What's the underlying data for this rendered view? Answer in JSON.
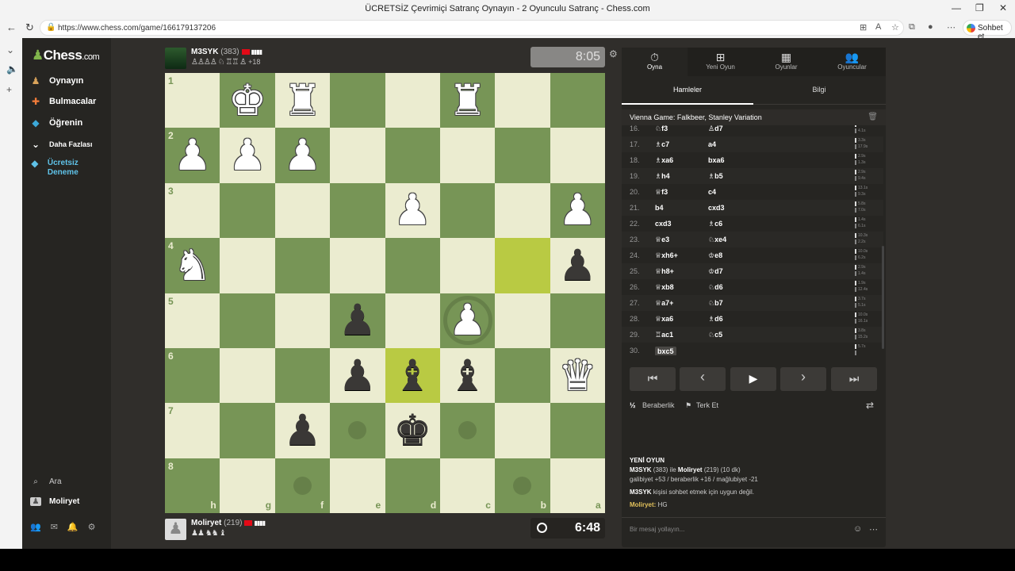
{
  "window": {
    "title": "ÜCRETSİZ Çevrimiçi Satranç Oynayın - 2 Oyunculu Satranç - Chess.com",
    "url": "https://www.chess.com/game/166179137206",
    "profile_label": "Sohbet et"
  },
  "sidebar": {
    "logo_text": "Chess",
    "logo_suffix": ".com",
    "items": [
      {
        "label": "Oynayın",
        "icon": "play-pawn-icon",
        "color": "#ffffff"
      },
      {
        "label": "Bulmacalar",
        "icon": "puzzle-icon",
        "color": "#ffffff"
      },
      {
        "label": "Öğrenin",
        "icon": "learn-cap-icon",
        "color": "#ffffff"
      },
      {
        "label": "Daha Fazlası",
        "icon": "chevron-down-icon",
        "color": "#ffffff"
      },
      {
        "label": "Ücretsiz Deneme",
        "icon": "diamond-icon",
        "color": "#5fc2e8"
      }
    ],
    "search_label": "Ara",
    "user_label": "Moliryet"
  },
  "top_player": {
    "name": "M3SYK",
    "rating": "(383)",
    "captured": "♙♙♙♙ ♘ ♖♖ ♙",
    "advantage": "+18",
    "clock": "8:05"
  },
  "bottom_player": {
    "name": "Moliryet",
    "rating": "(219)",
    "captured": "♟♟ ♞♞ ♝",
    "clock": "6:48"
  },
  "board": {
    "ranks": [
      "1",
      "2",
      "3",
      "4",
      "5",
      "6",
      "7",
      "8"
    ],
    "files": [
      "h",
      "g",
      "f",
      "e",
      "d",
      "c",
      "b",
      "a"
    ],
    "pieces": [
      {
        "sq": [
          1,
          0
        ],
        "glyph": "♚",
        "color": "w"
      },
      {
        "sq": [
          2,
          0
        ],
        "glyph": "♜",
        "color": "w"
      },
      {
        "sq": [
          5,
          0
        ],
        "glyph": "♜",
        "color": "w"
      },
      {
        "sq": [
          0,
          1
        ],
        "glyph": "♟",
        "color": "w"
      },
      {
        "sq": [
          1,
          1
        ],
        "glyph": "♟",
        "color": "w"
      },
      {
        "sq": [
          2,
          1
        ],
        "glyph": "♟",
        "color": "w"
      },
      {
        "sq": [
          4,
          2
        ],
        "glyph": "♟",
        "color": "w"
      },
      {
        "sq": [
          7,
          2
        ],
        "glyph": "♟",
        "color": "w"
      },
      {
        "sq": [
          0,
          3
        ],
        "glyph": "♞",
        "color": "w"
      },
      {
        "sq": [
          7,
          3
        ],
        "glyph": "♟",
        "color": "b"
      },
      {
        "sq": [
          3,
          4
        ],
        "glyph": "♟",
        "color": "b"
      },
      {
        "sq": [
          5,
          4
        ],
        "glyph": "♟",
        "color": "w"
      },
      {
        "sq": [
          3,
          5
        ],
        "glyph": "♟",
        "color": "b"
      },
      {
        "sq": [
          4,
          5
        ],
        "glyph": "♝",
        "color": "b"
      },
      {
        "sq": [
          5,
          5
        ],
        "glyph": "♝",
        "color": "b"
      },
      {
        "sq": [
          7,
          5
        ],
        "glyph": "♛",
        "color": "w"
      },
      {
        "sq": [
          2,
          6
        ],
        "glyph": "♟",
        "color": "b"
      },
      {
        "sq": [
          4,
          6
        ],
        "glyph": "♚",
        "color": "b"
      }
    ],
    "highlights": [
      [
        6,
        3
      ],
      [
        4,
        5
      ]
    ],
    "hints": [
      [
        3,
        6
      ],
      [
        5,
        6
      ],
      [
        2,
        7
      ],
      [
        6,
        7
      ]
    ],
    "ring": [
      5,
      4
    ]
  },
  "panel": {
    "tabs": [
      "Oyna",
      "Yeni Oyun",
      "Oyunlar",
      "Oyuncular"
    ],
    "subtabs": [
      "Hamleler",
      "Bilgi"
    ],
    "opening": "Vienna Game: Falkbeer, Stanley Variation",
    "moves": [
      {
        "n": "16.",
        "w": "♘f3",
        "b": "♙d7",
        "t1": "12.4s",
        "t2": "4.1s"
      },
      {
        "n": "17.",
        "w": "♗c7",
        "b": "a4",
        "t1": "3.3s",
        "t2": "17.9s"
      },
      {
        "n": "18.",
        "w": "♗xa6",
        "b": "bxa6",
        "t1": "2.9s",
        "t2": "1.3s"
      },
      {
        "n": "19.",
        "w": "♗h4",
        "b": "♗b5",
        "t1": "2.9s",
        "t2": "9.4s"
      },
      {
        "n": "20.",
        "w": "♕f3",
        "b": "c4",
        "t1": "13.1s",
        "t2": "9.3s"
      },
      {
        "n": "21.",
        "w": "b4",
        "b": "cxd3",
        "t1": "5.8s",
        "t2": "7.0s"
      },
      {
        "n": "22.",
        "w": "cxd3",
        "b": "♗c6",
        "t1": "1.4s",
        "t2": "6.1s"
      },
      {
        "n": "23.",
        "w": "♕e3",
        "b": "♘xe4",
        "t1": "10.3s",
        "t2": "2.2s"
      },
      {
        "n": "24.",
        "w": "♕xh6+",
        "b": "♔e8",
        "t1": "10.0s",
        "t2": "6.2s"
      },
      {
        "n": "25.",
        "w": "♕h8+",
        "b": "♔d7",
        "t1": "2.9s",
        "t2": "1.4s"
      },
      {
        "n": "26.",
        "w": "♕xb8",
        "b": "♘d6",
        "t1": "1.9s",
        "t2": "12.4s"
      },
      {
        "n": "27.",
        "w": "♕a7+",
        "b": "♘b7",
        "t1": "3.7s",
        "t2": "5.1s"
      },
      {
        "n": "28.",
        "w": "♕xa6",
        "b": "♗d6",
        "t1": "10.0s",
        "t2": "16.1s"
      },
      {
        "n": "29.",
        "w": "♖ac1",
        "b": "♘c5",
        "t1": "3.8s",
        "t2": "15.2s"
      },
      {
        "n": "30.",
        "w": "bxc5",
        "b": "",
        "t1": "5.7s",
        "t2": ""
      }
    ],
    "controls": [
      "⏮",
      "‹",
      "▶",
      "›",
      "⏭"
    ],
    "draw_label": "Beraberlik",
    "resign_label": "Terk Et",
    "chat": {
      "heading": "YENİ OYUN",
      "line1_a": "M3SYK",
      "line1_b": " (383) ile ",
      "line1_c": "Moliryet",
      "line1_d": " (219) (10 dk)",
      "line2": "galibiyet +53 / beraberlik +16 / mağlubiyet -21",
      "line3_name": "M3SYK",
      "line3_rest": " kişisi sohbet etmek için uygun değil.",
      "line4_name": "Moliryet:",
      "line4_rest": " HG",
      "placeholder": "Bir mesaj yollayın..."
    }
  }
}
